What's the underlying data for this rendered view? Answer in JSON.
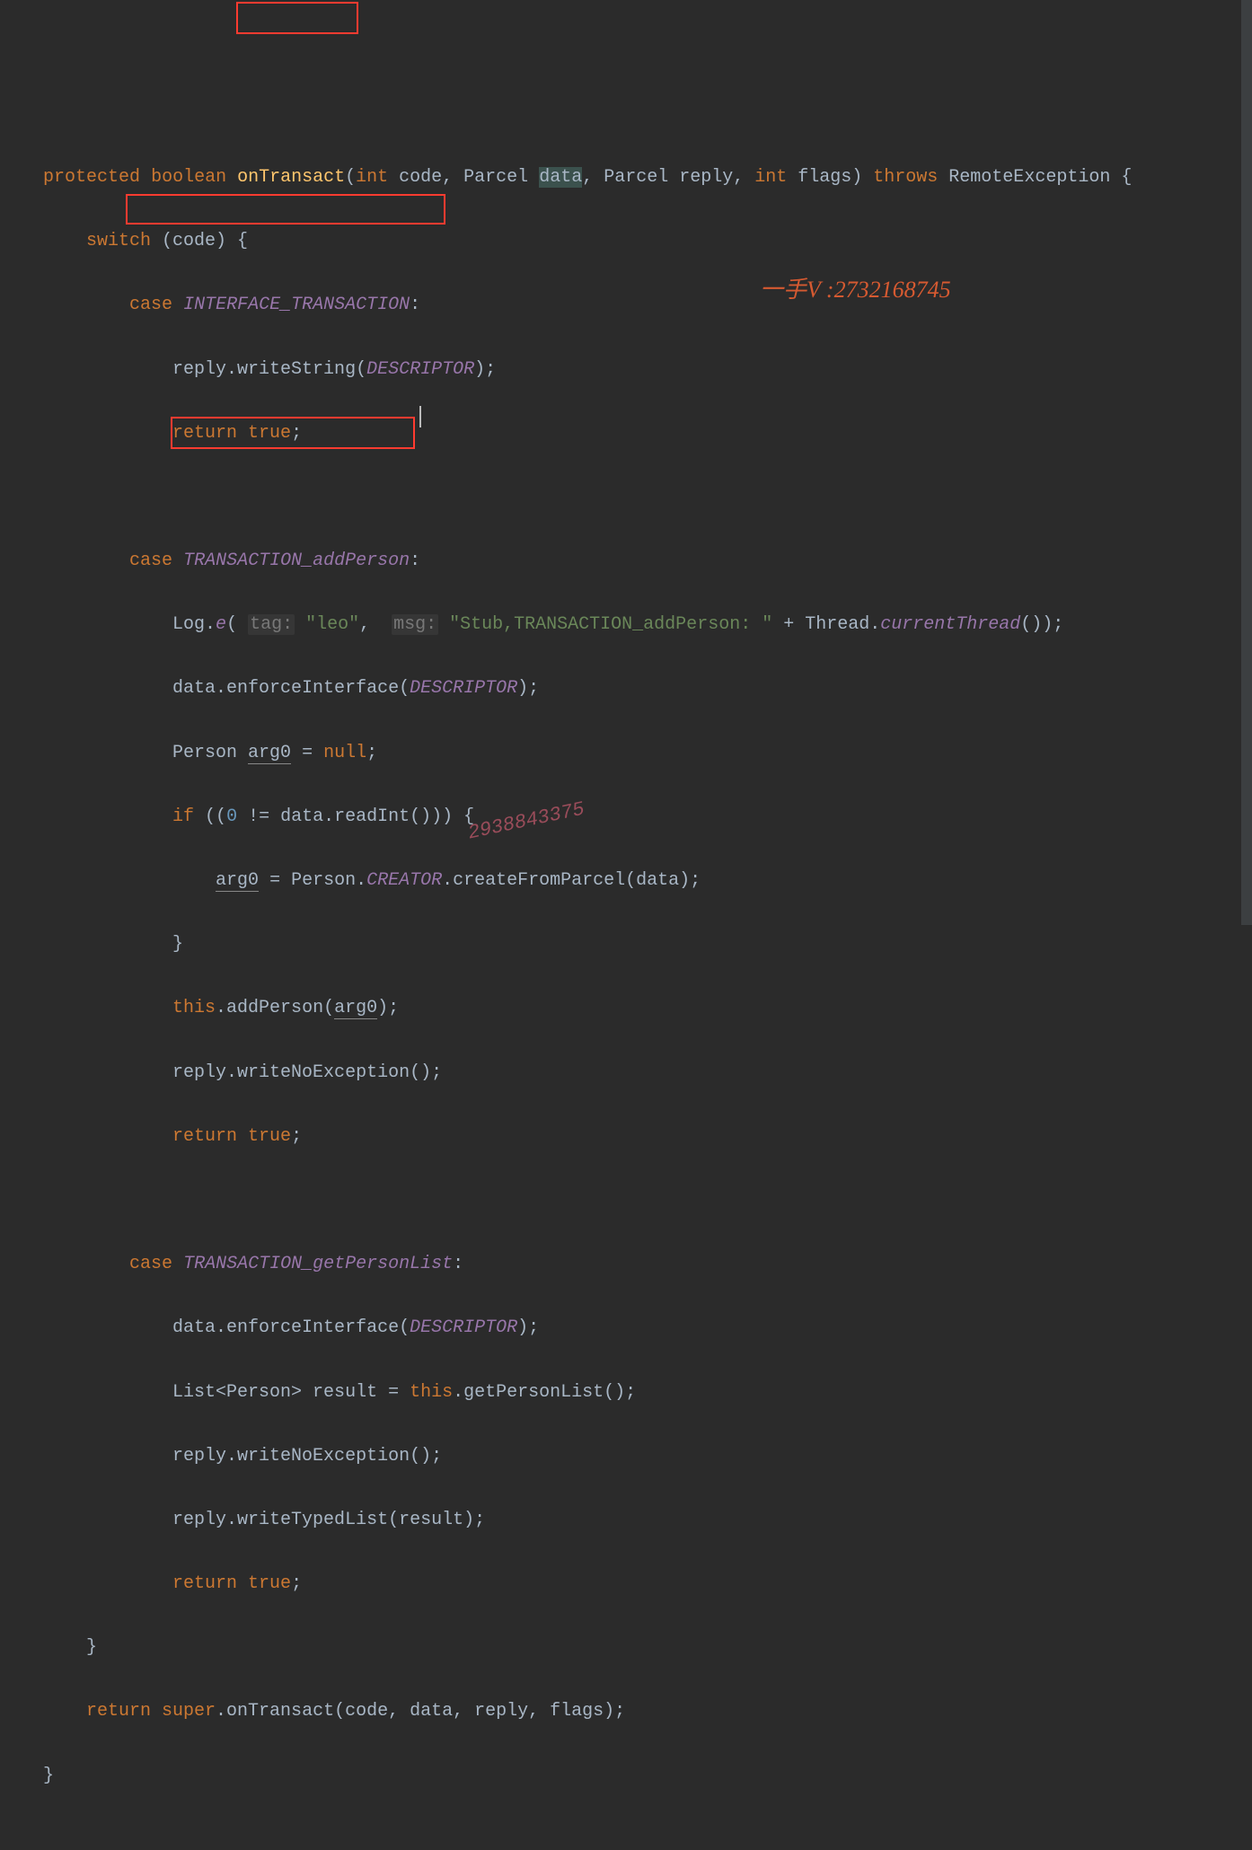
{
  "watermarks": {
    "w1": "一手V :2732168745",
    "w2": "2938843375"
  },
  "code": {
    "l1_protected": "protected",
    "l1_boolean": "boolean",
    "l1_onTransact": "onTransact",
    "l1_int1": "int",
    "l1_code": " code, ",
    "l1_Parcel1": "Parcel ",
    "l1_data": "data",
    "l1_comma": ", ",
    "l1_Parcel2": "Parcel reply, ",
    "l1_int2": "int",
    "l1_flags": " flags) ",
    "l1_throws": "throws",
    "l1_remote": " RemoteException {",
    "l2_switch": "switch",
    "l2_rest": " (code) {",
    "l3_case": "case",
    "l3_const": "INTERFACE_TRANSACTION",
    "l3_colon": ":",
    "l4_a": "reply.writeString(",
    "l4_desc": "DESCRIPTOR",
    "l4_b": ");",
    "l5_return": "return",
    "l5_true": " true",
    "l5_semi": ";",
    "l7_case": "case",
    "l7_const": "TRANSACTION_addPerson",
    "l7_colon": ":",
    "l8_a": "Log.",
    "l8_e": "e",
    "l8_op": "( ",
    "l8_tag_hint": "tag:",
    "l8_tag_v": " \"leo\"",
    "l8_c1": ",  ",
    "l8_msg_hint": "msg:",
    "l8_msg_v": " \"Stub,TRANSACTION_addPerson: \"",
    "l8_plus": " + Thread.",
    "l8_ct": "currentThread",
    "l8_end": "());",
    "l9_a": "data.enforceInterface(",
    "l9_desc": "DESCRIPTOR",
    "l9_b": ");",
    "l10_a": "Person ",
    "l10_arg": "arg0",
    "l10_b": " = ",
    "l10_null": "null",
    "l10_semi": ";",
    "l11_if": "if",
    "l11_cond": " ((",
    "l11_zero": "0",
    "l11_rest": " != data.readInt())) {",
    "l12_arg": "arg0",
    "l12_a": " = Person.",
    "l12_creator": "CREATOR",
    "l12_b": ".createFromParcel(data);",
    "l13_brace": "}",
    "l14_this": "this",
    "l14_a": ".addPerson(",
    "l14_arg": "arg0",
    "l14_b": ");",
    "l15": "reply.writeNoException();",
    "l16_return": "return",
    "l16_true": " true",
    "l16_semi": ";",
    "l18_case": "case",
    "l18_const": "TRANSACTION_getPersonList",
    "l18_colon": ":",
    "l19_a": "data.enforceInterface(",
    "l19_desc": "DESCRIPTOR",
    "l19_b": ");",
    "l20_a": "List<Person> result = ",
    "l20_this": "this",
    "l20_b": ".getPersonList();",
    "l21": "reply.writeNoException();",
    "l22": "reply.writeTypedList(result);",
    "l23_return": "return",
    "l23_true": " true",
    "l23_semi": ";",
    "l24_brace": "}",
    "l25_return": "return",
    "l25_super": " super",
    "l25_rest": ".onTransact(code, data, reply, flags);",
    "l26_brace": "}"
  }
}
